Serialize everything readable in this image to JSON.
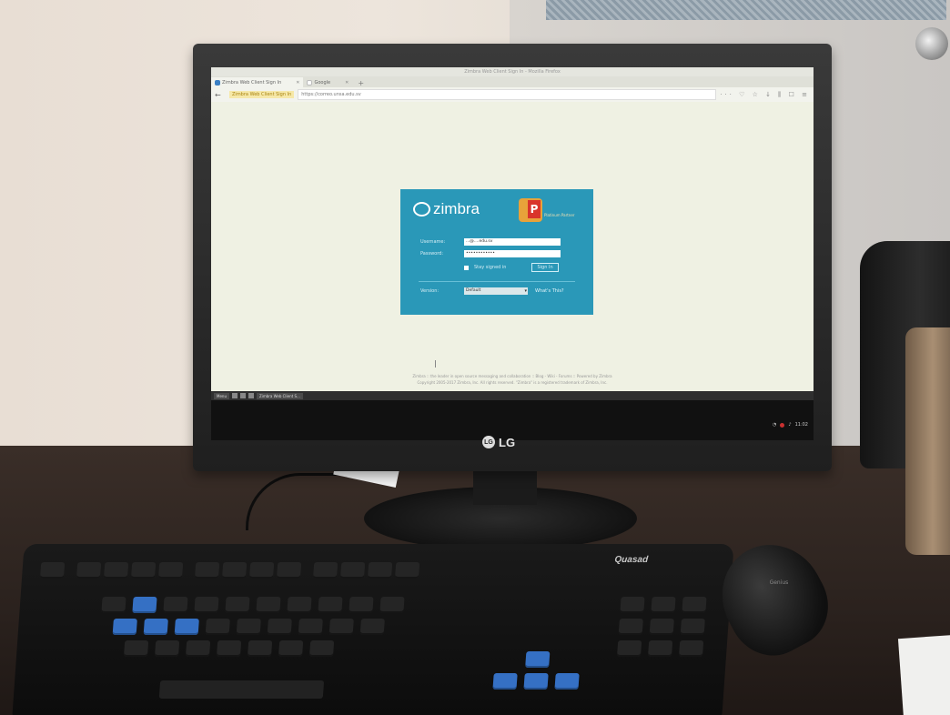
{
  "browser": {
    "window_title": "Zimbra Web Client Sign In - Mozilla Firefox",
    "tabs": [
      {
        "label": "Zimbra Web Client Sign In",
        "active": true
      },
      {
        "label": "Google",
        "active": false
      }
    ],
    "reader_badge": "Zimbra Web Client Sign In",
    "url": "https://correo.unsa.edu.sv",
    "url_domain": "unsa.edu.sv"
  },
  "login": {
    "logo_text": "zimbra",
    "partner_text": "Platinum Partner",
    "username_label": "Username:",
    "username_value": "...@....edu.sv",
    "password_label": "Password:",
    "password_value": "••••••••••••",
    "stay_signed_in": "Stay signed in",
    "sign_in_button": "Sign In",
    "version_label": "Version:",
    "version_value": "Default",
    "whats_this": "What's This?"
  },
  "footer": {
    "line1": "Zimbra :: the leader in open source messaging and collaboration :: Blog - Wiki - Forums :: Powered by Zimbra",
    "line2": "Copyright 2005-2017 Zimbra, Inc. All rights reserved. \"Zimbra\" is a registered trademark of Zimbra, Inc."
  },
  "taskbar": {
    "menu_label": "Menu",
    "window_label": "Zimbra Web Client S...",
    "clock": "11:02"
  },
  "monitor": {
    "brand": "LG"
  },
  "keyboard": {
    "brand": "Quasad"
  },
  "mouse": {
    "brand": "Genius"
  },
  "colors": {
    "login_card": "#2a98b8",
    "page_bg": "#eff1e3",
    "arrow_keys": "#3570c4"
  }
}
